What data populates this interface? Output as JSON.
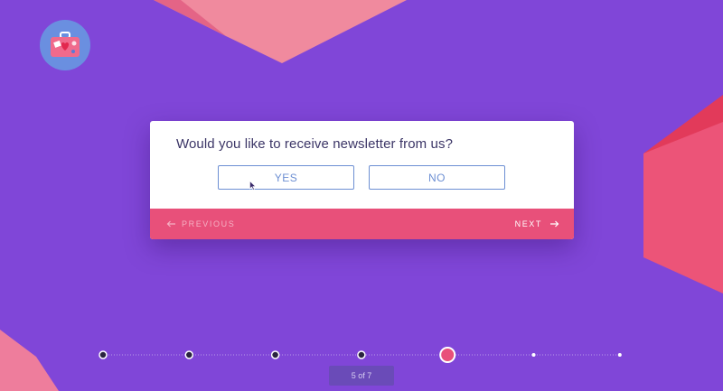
{
  "app": {
    "logo_icon": "suitcase-heart-icon"
  },
  "survey": {
    "question": "Would you like to receive newsletter from us?",
    "options": [
      "YES",
      "NO"
    ],
    "hovered_option": "YES"
  },
  "nav": {
    "previous_label": "PREVIOUS",
    "next_label": "NEXT",
    "previous_icon": "arrow-left-icon",
    "next_icon": "arrow-right-icon"
  },
  "progress": {
    "current_step": 5,
    "total_steps": 7,
    "label": "5 of 7"
  },
  "colors": {
    "background": "#8046d8",
    "accent": "#e8507a",
    "button_border": "#6d8fd3",
    "question_text": "#3b3566"
  }
}
